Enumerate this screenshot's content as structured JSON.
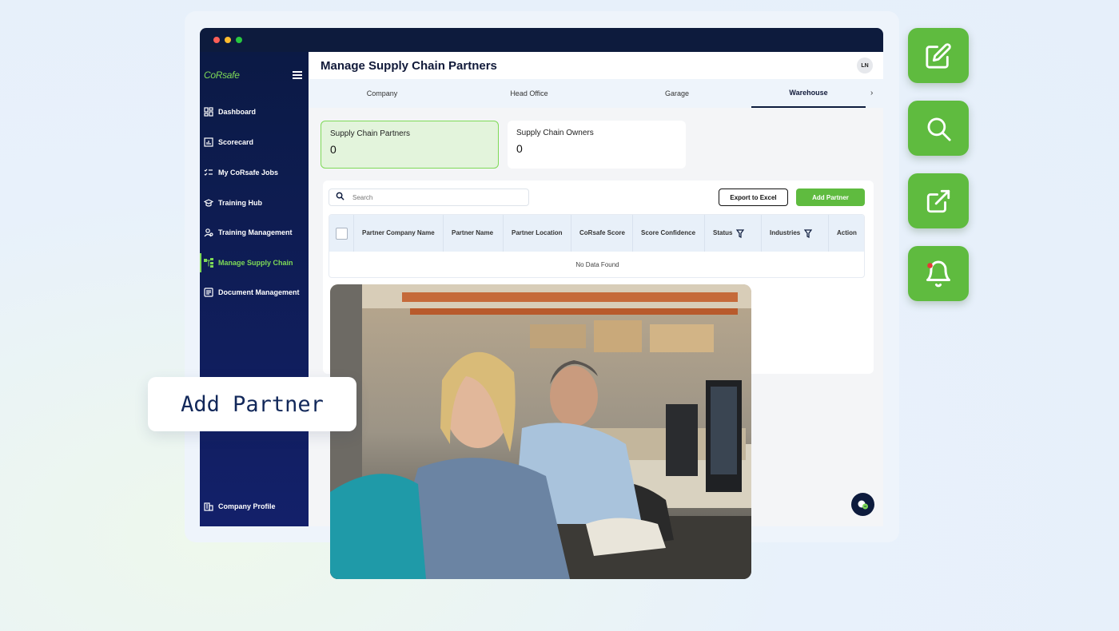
{
  "app": {
    "logo": "CoRsafe",
    "page_title": "Manage Supply Chain Partners",
    "user_initials": "LN"
  },
  "sidebar": {
    "items": [
      {
        "label": "Dashboard",
        "icon": "dashboard-icon",
        "active": false
      },
      {
        "label": "Scorecard",
        "icon": "chart-icon",
        "active": false
      },
      {
        "label": "My CoRsafe Jobs",
        "icon": "checklist-icon",
        "active": false
      },
      {
        "label": "Training Hub",
        "icon": "graduation-cap-icon",
        "active": false
      },
      {
        "label": "Training Management",
        "icon": "users-icon",
        "active": false
      },
      {
        "label": "Manage Supply Chain",
        "icon": "supply-chain-icon",
        "active": true
      },
      {
        "label": "Document Management",
        "icon": "document-icon",
        "active": false
      }
    ],
    "footer": {
      "label": "Company Profile",
      "icon": "building-icon"
    }
  },
  "tabs": [
    {
      "label": "Company",
      "active": false
    },
    {
      "label": "Head Office",
      "active": false
    },
    {
      "label": "Garage",
      "active": false
    },
    {
      "label": "Warehouse",
      "active": true
    }
  ],
  "stats": [
    {
      "label": "Supply Chain Partners",
      "value": "0",
      "highlight": true
    },
    {
      "label": "Supply Chain Owners",
      "value": "0",
      "highlight": false
    }
  ],
  "toolbar": {
    "search_placeholder": "Search",
    "export_label": "Export to Excel",
    "add_label": "Add Partner"
  },
  "table": {
    "columns": [
      "Partner Company Name",
      "Partner Name",
      "Partner Location",
      "CoRsafe Score",
      "Score Confidence",
      "Status",
      "Industries",
      "Action"
    ],
    "empty_text": "No Data Found"
  },
  "callout": {
    "text": "Add Partner"
  },
  "actions": [
    {
      "icon": "edit-icon"
    },
    {
      "icon": "search-icon"
    },
    {
      "icon": "external-link-icon"
    },
    {
      "icon": "bell-icon"
    }
  ],
  "colors": {
    "brand_green": "#5fbb3f",
    "navy": "#0d1b3d",
    "sidebar_active": "#7ed957"
  }
}
